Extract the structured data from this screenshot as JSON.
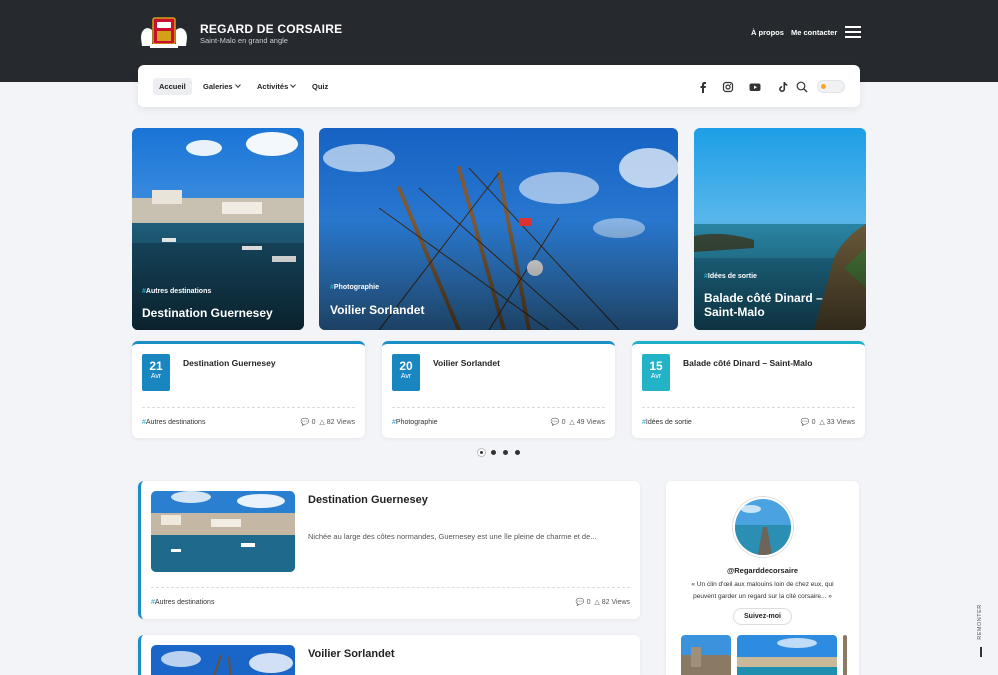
{
  "header": {
    "brand_title": "REGARD DE CORSAIRE",
    "brand_sub": "Saint-Malo en grand angle",
    "links": [
      "À propos",
      "Me contacter"
    ]
  },
  "nav": {
    "items": [
      {
        "label": "Accueil",
        "active": true
      },
      {
        "label": "Galeries",
        "dropdown": true
      },
      {
        "label": "Activités",
        "dropdown": true
      },
      {
        "label": "Quiz"
      }
    ],
    "social_icons": [
      "facebook-icon",
      "instagram-icon",
      "youtube-icon",
      "tiktok-icon",
      "search-icon"
    ]
  },
  "hero": [
    {
      "category": "Autres destinations",
      "title": "Destination Guernesey"
    },
    {
      "category": "Photographie",
      "title": "Voilier Sorlandet"
    },
    {
      "category": "Idées de sortie",
      "title": "Balade côté Dinard – Saint-Malo"
    }
  ],
  "mini_cards": [
    {
      "day": "21",
      "month": "Avr",
      "title": "Destination Guernesey",
      "category": "Autres destinations",
      "comments": "0",
      "views": "82 Views"
    },
    {
      "day": "20",
      "month": "Avr",
      "title": "Voilier Sorlandet",
      "category": "Photographie",
      "comments": "0",
      "views": "49 Views"
    },
    {
      "day": "15",
      "month": "Avr",
      "title": "Balade côté Dinard – Saint-Malo",
      "category": "Idées de sortie",
      "comments": "0",
      "views": "33 Views"
    }
  ],
  "pager": {
    "count": 4,
    "active": 1
  },
  "posts": [
    {
      "title": "Destination Guernesey",
      "excerpt": "Nichée au large des côtes normandes, Guernesey est une île pleine de charme et de...",
      "category": "Autres destinations",
      "comments": "0",
      "views": "82 Views"
    },
    {
      "title": "Voilier Sorlandet"
    }
  ],
  "sidebar": {
    "handle": "@Regarddecorsaire",
    "bio": "« Un clin d'œil aux malouins loin de chez eux, qui peuvent garder un regard sur la cité corsaire... »",
    "follow_label": "Suivez-moi"
  },
  "remonter": "REMONTER",
  "colors": {
    "accent": "#1a8fc4",
    "topbar": "#262a2f",
    "hash": "#2aa6c9"
  }
}
